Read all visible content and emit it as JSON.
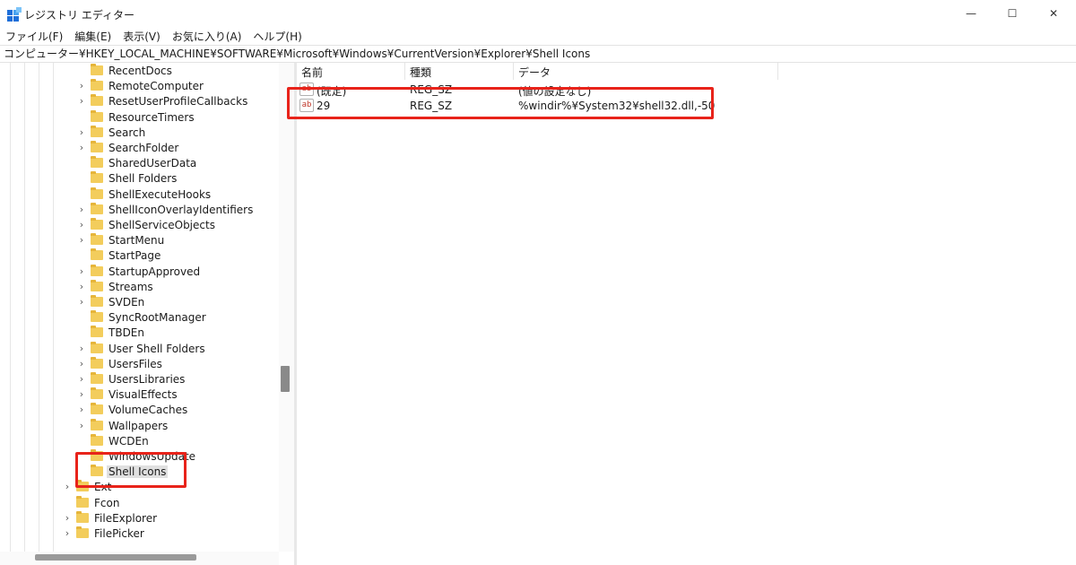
{
  "window": {
    "title": "レジストリ エディター",
    "minimize_glyph": "—",
    "maximize_glyph": "☐",
    "close_glyph": "✕",
    "icon": "registry-editor-icon"
  },
  "menu": [
    "ファイル(F)",
    "編集(E)",
    "表示(V)",
    "お気に入り(A)",
    "ヘルプ(H)"
  ],
  "address": "コンピューター¥HKEY_LOCAL_MACHINE¥SOFTWARE¥Microsoft¥Windows¥CurrentVersion¥Explorer¥Shell Icons",
  "tree": {
    "chevron_glyph": "›",
    "nodes": [
      {
        "label": "RecentDocs",
        "expandable": false
      },
      {
        "label": "RemoteComputer",
        "expandable": true
      },
      {
        "label": "ResetUserProfileCallbacks",
        "expandable": true
      },
      {
        "label": "ResourceTimers",
        "expandable": false
      },
      {
        "label": "Search",
        "expandable": true
      },
      {
        "label": "SearchFolder",
        "expandable": true
      },
      {
        "label": "SharedUserData",
        "expandable": false
      },
      {
        "label": "Shell Folders",
        "expandable": false
      },
      {
        "label": "ShellExecuteHooks",
        "expandable": false
      },
      {
        "label": "ShellIconOverlayIdentifiers",
        "expandable": true
      },
      {
        "label": "ShellServiceObjects",
        "expandable": true
      },
      {
        "label": "StartMenu",
        "expandable": true
      },
      {
        "label": "StartPage",
        "expandable": false
      },
      {
        "label": "StartupApproved",
        "expandable": true
      },
      {
        "label": "Streams",
        "expandable": true
      },
      {
        "label": "SVDEn",
        "expandable": true
      },
      {
        "label": "SyncRootManager",
        "expandable": false
      },
      {
        "label": "TBDEn",
        "expandable": false
      },
      {
        "label": "User Shell Folders",
        "expandable": true
      },
      {
        "label": "UsersFiles",
        "expandable": true
      },
      {
        "label": "UsersLibraries",
        "expandable": true
      },
      {
        "label": "VisualEffects",
        "expandable": true
      },
      {
        "label": "VolumeCaches",
        "expandable": true
      },
      {
        "label": "Wallpapers",
        "expandable": true
      },
      {
        "label": "WCDEn",
        "expandable": false
      },
      {
        "label": "WindowsUpdate",
        "expandable": false
      },
      {
        "label": "Shell Icons",
        "expandable": false,
        "selected": true
      },
      {
        "label": "Ext",
        "expandable": true,
        "level": 1
      },
      {
        "label": "Fcon",
        "expandable": false,
        "level": 1
      },
      {
        "label": "FileExplorer",
        "expandable": true,
        "level": 1
      },
      {
        "label": "FilePicker",
        "expandable": true,
        "level": 1
      }
    ]
  },
  "list": {
    "columns": [
      "名前",
      "種類",
      "データ"
    ],
    "rows": [
      {
        "name": "(既定)",
        "type": "REG_SZ",
        "data": "(値の設定なし)",
        "icon": "ab"
      },
      {
        "name": "29",
        "type": "REG_SZ",
        "data": "%windir%¥System32¥shell32.dll,-50",
        "icon": "ab"
      }
    ]
  },
  "colors": {
    "highlight": "#e8231a",
    "folder": "#f3cd5c",
    "selection": "#e0e0e0"
  }
}
